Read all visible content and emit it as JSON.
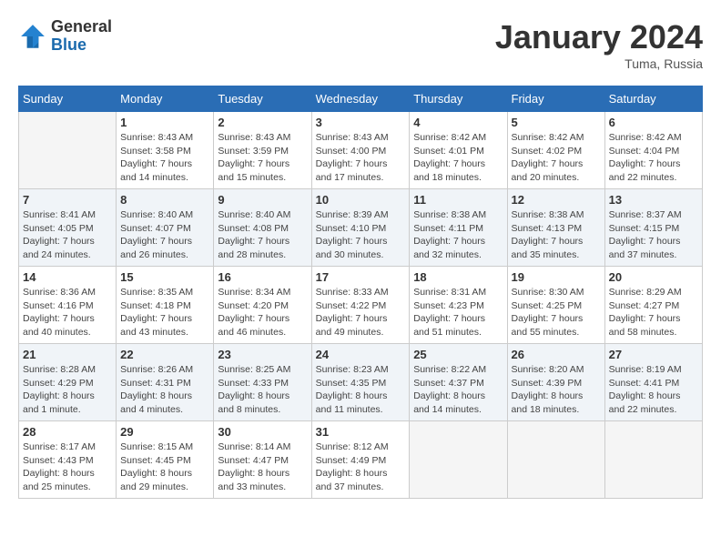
{
  "header": {
    "logo_general": "General",
    "logo_blue": "Blue",
    "month_title": "January 2024",
    "location": "Tuma, Russia"
  },
  "columns": [
    "Sunday",
    "Monday",
    "Tuesday",
    "Wednesday",
    "Thursday",
    "Friday",
    "Saturday"
  ],
  "weeks": [
    [
      {
        "day": "",
        "sunrise": "",
        "sunset": "",
        "daylight": ""
      },
      {
        "day": "1",
        "sunrise": "Sunrise: 8:43 AM",
        "sunset": "Sunset: 3:58 PM",
        "daylight": "Daylight: 7 hours and 14 minutes."
      },
      {
        "day": "2",
        "sunrise": "Sunrise: 8:43 AM",
        "sunset": "Sunset: 3:59 PM",
        "daylight": "Daylight: 7 hours and 15 minutes."
      },
      {
        "day": "3",
        "sunrise": "Sunrise: 8:43 AM",
        "sunset": "Sunset: 4:00 PM",
        "daylight": "Daylight: 7 hours and 17 minutes."
      },
      {
        "day": "4",
        "sunrise": "Sunrise: 8:42 AM",
        "sunset": "Sunset: 4:01 PM",
        "daylight": "Daylight: 7 hours and 18 minutes."
      },
      {
        "day": "5",
        "sunrise": "Sunrise: 8:42 AM",
        "sunset": "Sunset: 4:02 PM",
        "daylight": "Daylight: 7 hours and 20 minutes."
      },
      {
        "day": "6",
        "sunrise": "Sunrise: 8:42 AM",
        "sunset": "Sunset: 4:04 PM",
        "daylight": "Daylight: 7 hours and 22 minutes."
      }
    ],
    [
      {
        "day": "7",
        "sunrise": "Sunrise: 8:41 AM",
        "sunset": "Sunset: 4:05 PM",
        "daylight": "Daylight: 7 hours and 24 minutes."
      },
      {
        "day": "8",
        "sunrise": "Sunrise: 8:40 AM",
        "sunset": "Sunset: 4:07 PM",
        "daylight": "Daylight: 7 hours and 26 minutes."
      },
      {
        "day": "9",
        "sunrise": "Sunrise: 8:40 AM",
        "sunset": "Sunset: 4:08 PM",
        "daylight": "Daylight: 7 hours and 28 minutes."
      },
      {
        "day": "10",
        "sunrise": "Sunrise: 8:39 AM",
        "sunset": "Sunset: 4:10 PM",
        "daylight": "Daylight: 7 hours and 30 minutes."
      },
      {
        "day": "11",
        "sunrise": "Sunrise: 8:38 AM",
        "sunset": "Sunset: 4:11 PM",
        "daylight": "Daylight: 7 hours and 32 minutes."
      },
      {
        "day": "12",
        "sunrise": "Sunrise: 8:38 AM",
        "sunset": "Sunset: 4:13 PM",
        "daylight": "Daylight: 7 hours and 35 minutes."
      },
      {
        "day": "13",
        "sunrise": "Sunrise: 8:37 AM",
        "sunset": "Sunset: 4:15 PM",
        "daylight": "Daylight: 7 hours and 37 minutes."
      }
    ],
    [
      {
        "day": "14",
        "sunrise": "Sunrise: 8:36 AM",
        "sunset": "Sunset: 4:16 PM",
        "daylight": "Daylight: 7 hours and 40 minutes."
      },
      {
        "day": "15",
        "sunrise": "Sunrise: 8:35 AM",
        "sunset": "Sunset: 4:18 PM",
        "daylight": "Daylight: 7 hours and 43 minutes."
      },
      {
        "day": "16",
        "sunrise": "Sunrise: 8:34 AM",
        "sunset": "Sunset: 4:20 PM",
        "daylight": "Daylight: 7 hours and 46 minutes."
      },
      {
        "day": "17",
        "sunrise": "Sunrise: 8:33 AM",
        "sunset": "Sunset: 4:22 PM",
        "daylight": "Daylight: 7 hours and 49 minutes."
      },
      {
        "day": "18",
        "sunrise": "Sunrise: 8:31 AM",
        "sunset": "Sunset: 4:23 PM",
        "daylight": "Daylight: 7 hours and 51 minutes."
      },
      {
        "day": "19",
        "sunrise": "Sunrise: 8:30 AM",
        "sunset": "Sunset: 4:25 PM",
        "daylight": "Daylight: 7 hours and 55 minutes."
      },
      {
        "day": "20",
        "sunrise": "Sunrise: 8:29 AM",
        "sunset": "Sunset: 4:27 PM",
        "daylight": "Daylight: 7 hours and 58 minutes."
      }
    ],
    [
      {
        "day": "21",
        "sunrise": "Sunrise: 8:28 AM",
        "sunset": "Sunset: 4:29 PM",
        "daylight": "Daylight: 8 hours and 1 minute."
      },
      {
        "day": "22",
        "sunrise": "Sunrise: 8:26 AM",
        "sunset": "Sunset: 4:31 PM",
        "daylight": "Daylight: 8 hours and 4 minutes."
      },
      {
        "day": "23",
        "sunrise": "Sunrise: 8:25 AM",
        "sunset": "Sunset: 4:33 PM",
        "daylight": "Daylight: 8 hours and 8 minutes."
      },
      {
        "day": "24",
        "sunrise": "Sunrise: 8:23 AM",
        "sunset": "Sunset: 4:35 PM",
        "daylight": "Daylight: 8 hours and 11 minutes."
      },
      {
        "day": "25",
        "sunrise": "Sunrise: 8:22 AM",
        "sunset": "Sunset: 4:37 PM",
        "daylight": "Daylight: 8 hours and 14 minutes."
      },
      {
        "day": "26",
        "sunrise": "Sunrise: 8:20 AM",
        "sunset": "Sunset: 4:39 PM",
        "daylight": "Daylight: 8 hours and 18 minutes."
      },
      {
        "day": "27",
        "sunrise": "Sunrise: 8:19 AM",
        "sunset": "Sunset: 4:41 PM",
        "daylight": "Daylight: 8 hours and 22 minutes."
      }
    ],
    [
      {
        "day": "28",
        "sunrise": "Sunrise: 8:17 AM",
        "sunset": "Sunset: 4:43 PM",
        "daylight": "Daylight: 8 hours and 25 minutes."
      },
      {
        "day": "29",
        "sunrise": "Sunrise: 8:15 AM",
        "sunset": "Sunset: 4:45 PM",
        "daylight": "Daylight: 8 hours and 29 minutes."
      },
      {
        "day": "30",
        "sunrise": "Sunrise: 8:14 AM",
        "sunset": "Sunset: 4:47 PM",
        "daylight": "Daylight: 8 hours and 33 minutes."
      },
      {
        "day": "31",
        "sunrise": "Sunrise: 8:12 AM",
        "sunset": "Sunset: 4:49 PM",
        "daylight": "Daylight: 8 hours and 37 minutes."
      },
      {
        "day": "",
        "sunrise": "",
        "sunset": "",
        "daylight": ""
      },
      {
        "day": "",
        "sunrise": "",
        "sunset": "",
        "daylight": ""
      },
      {
        "day": "",
        "sunrise": "",
        "sunset": "",
        "daylight": ""
      }
    ]
  ]
}
